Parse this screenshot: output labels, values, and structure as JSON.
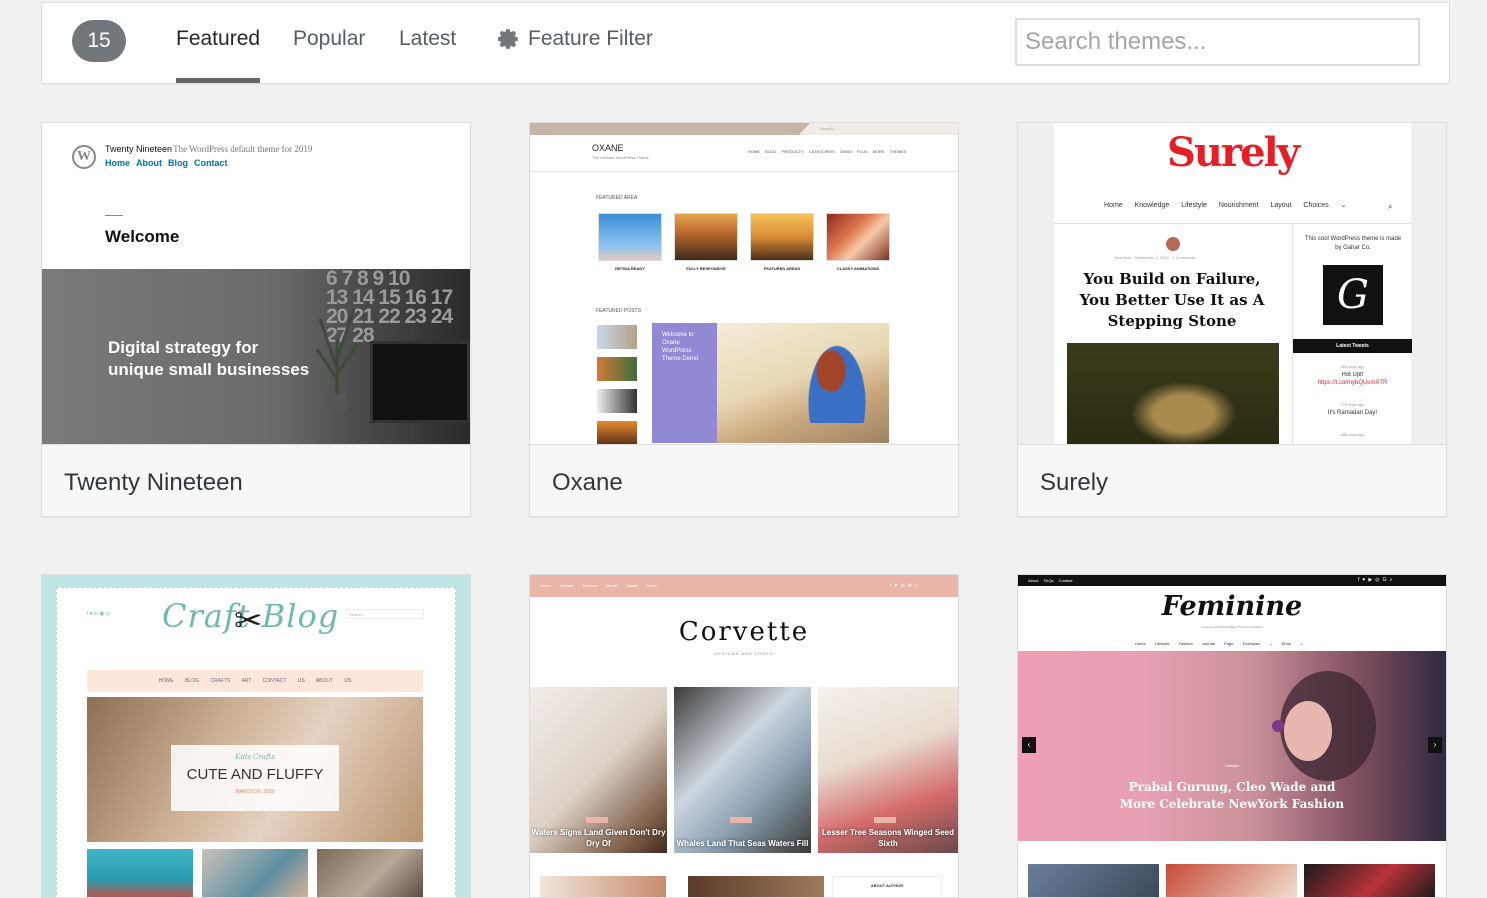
{
  "filter": {
    "count": "15",
    "tabs": {
      "featured": "Featured",
      "popular": "Popular",
      "latest": "Latest"
    },
    "feature_filter": "Feature Filter",
    "search_placeholder": "Search themes..."
  },
  "themes": {
    "twentynineteen": {
      "name": "Twenty Nineteen",
      "preview": {
        "site_title": "Twenty Nineteen",
        "tagline": "— The WordPress default theme for 2019",
        "nav": [
          "Home",
          "About",
          "Blog",
          "Contact"
        ],
        "welcome": "Welcome",
        "hero_line1": "Digital strategy for",
        "hero_line2": "unique small businesses",
        "cal_row1": "6 7 8 9 10",
        "cal_row2": "13 14 15 16 17",
        "cal_row3": "20 21 22 23 24",
        "cal_row4": "27 28"
      }
    },
    "oxane": {
      "name": "Oxane",
      "preview": {
        "logo": "OXANE",
        "sub": "The Ultimate WordPress Theme",
        "nav": "HOME BLOG PRODUCTS CATEGORIES DEMO PLUS MORE THEMES",
        "search": "Search...",
        "featured_area": "FEATURED AREA",
        "features": [
          "RETINA READY",
          "FULLY RESPONSIVE",
          "FEATURED AREAS",
          "CLASSY ANIMATIONS"
        ],
        "featured_posts": "FEATURED POSTS",
        "welcome": "Welcome to Oxane WordPress Theme Demo"
      }
    },
    "surely": {
      "name": "Surely",
      "preview": {
        "logo": "Surely",
        "nav": "Home Knowledge Lifestyle Nourishment Layout Choices ⌄",
        "meta": "John Doe · September 1, 2016 · 2 Comments",
        "title": "You Build on Failure, You Better Use It as A Stepping Stone",
        "side_text": "This cool WordPress theme is made by Gahar Co.",
        "tweets_heading": "Latest Tweets",
        "tweet1_ago": "309 days ago",
        "tweet1": "Hot Upt!",
        "tweet1_link": "https://t.co/mybQUsmXTR",
        "tweet2_ago": "373 days ago",
        "tweet2": "It's Ramadan Day!",
        "tweet3_ago": "286 days ago"
      }
    },
    "craftblog": {
      "preview": {
        "logo": "Craft Blog",
        "nav": "HOME BLOG CRAFTS ART CONTACT US ABOUT US",
        "search": "Search...",
        "hero_sub": "Kids Crafts",
        "hero_title": "CUTE AND FLUFFY",
        "hero_date": "MARCH 26, 2019"
      }
    },
    "corvette": {
      "preview": {
        "nav": "Home Contact Fashion Media Sports Travel",
        "logo": "Corvette",
        "tagline": "DESIGNS AND LOOKS",
        "captions": [
          "Waters Signs Land Given Don't Dry Dry Of",
          "Whales Land That Seas Waters Fill",
          "Lesser Tree Seasons Winged Seed Sixth"
        ],
        "about": "ABOUT AUTHOR"
      }
    },
    "feminine": {
      "preview": {
        "topnav": "About FAQs Contact",
        "logo": "Feminine",
        "sub": "Feminine WordPress Blog Theme for Fashion",
        "nav": "Home Lifestyle Fashion Journal Page Examples ⌄ Shop ⌄",
        "hero_sub": "Lifestyle",
        "hero_title_1": "Prabal Gurung, Cleo Wade and",
        "hero_title_2": "More Celebrate NewYork Fashion"
      }
    }
  }
}
